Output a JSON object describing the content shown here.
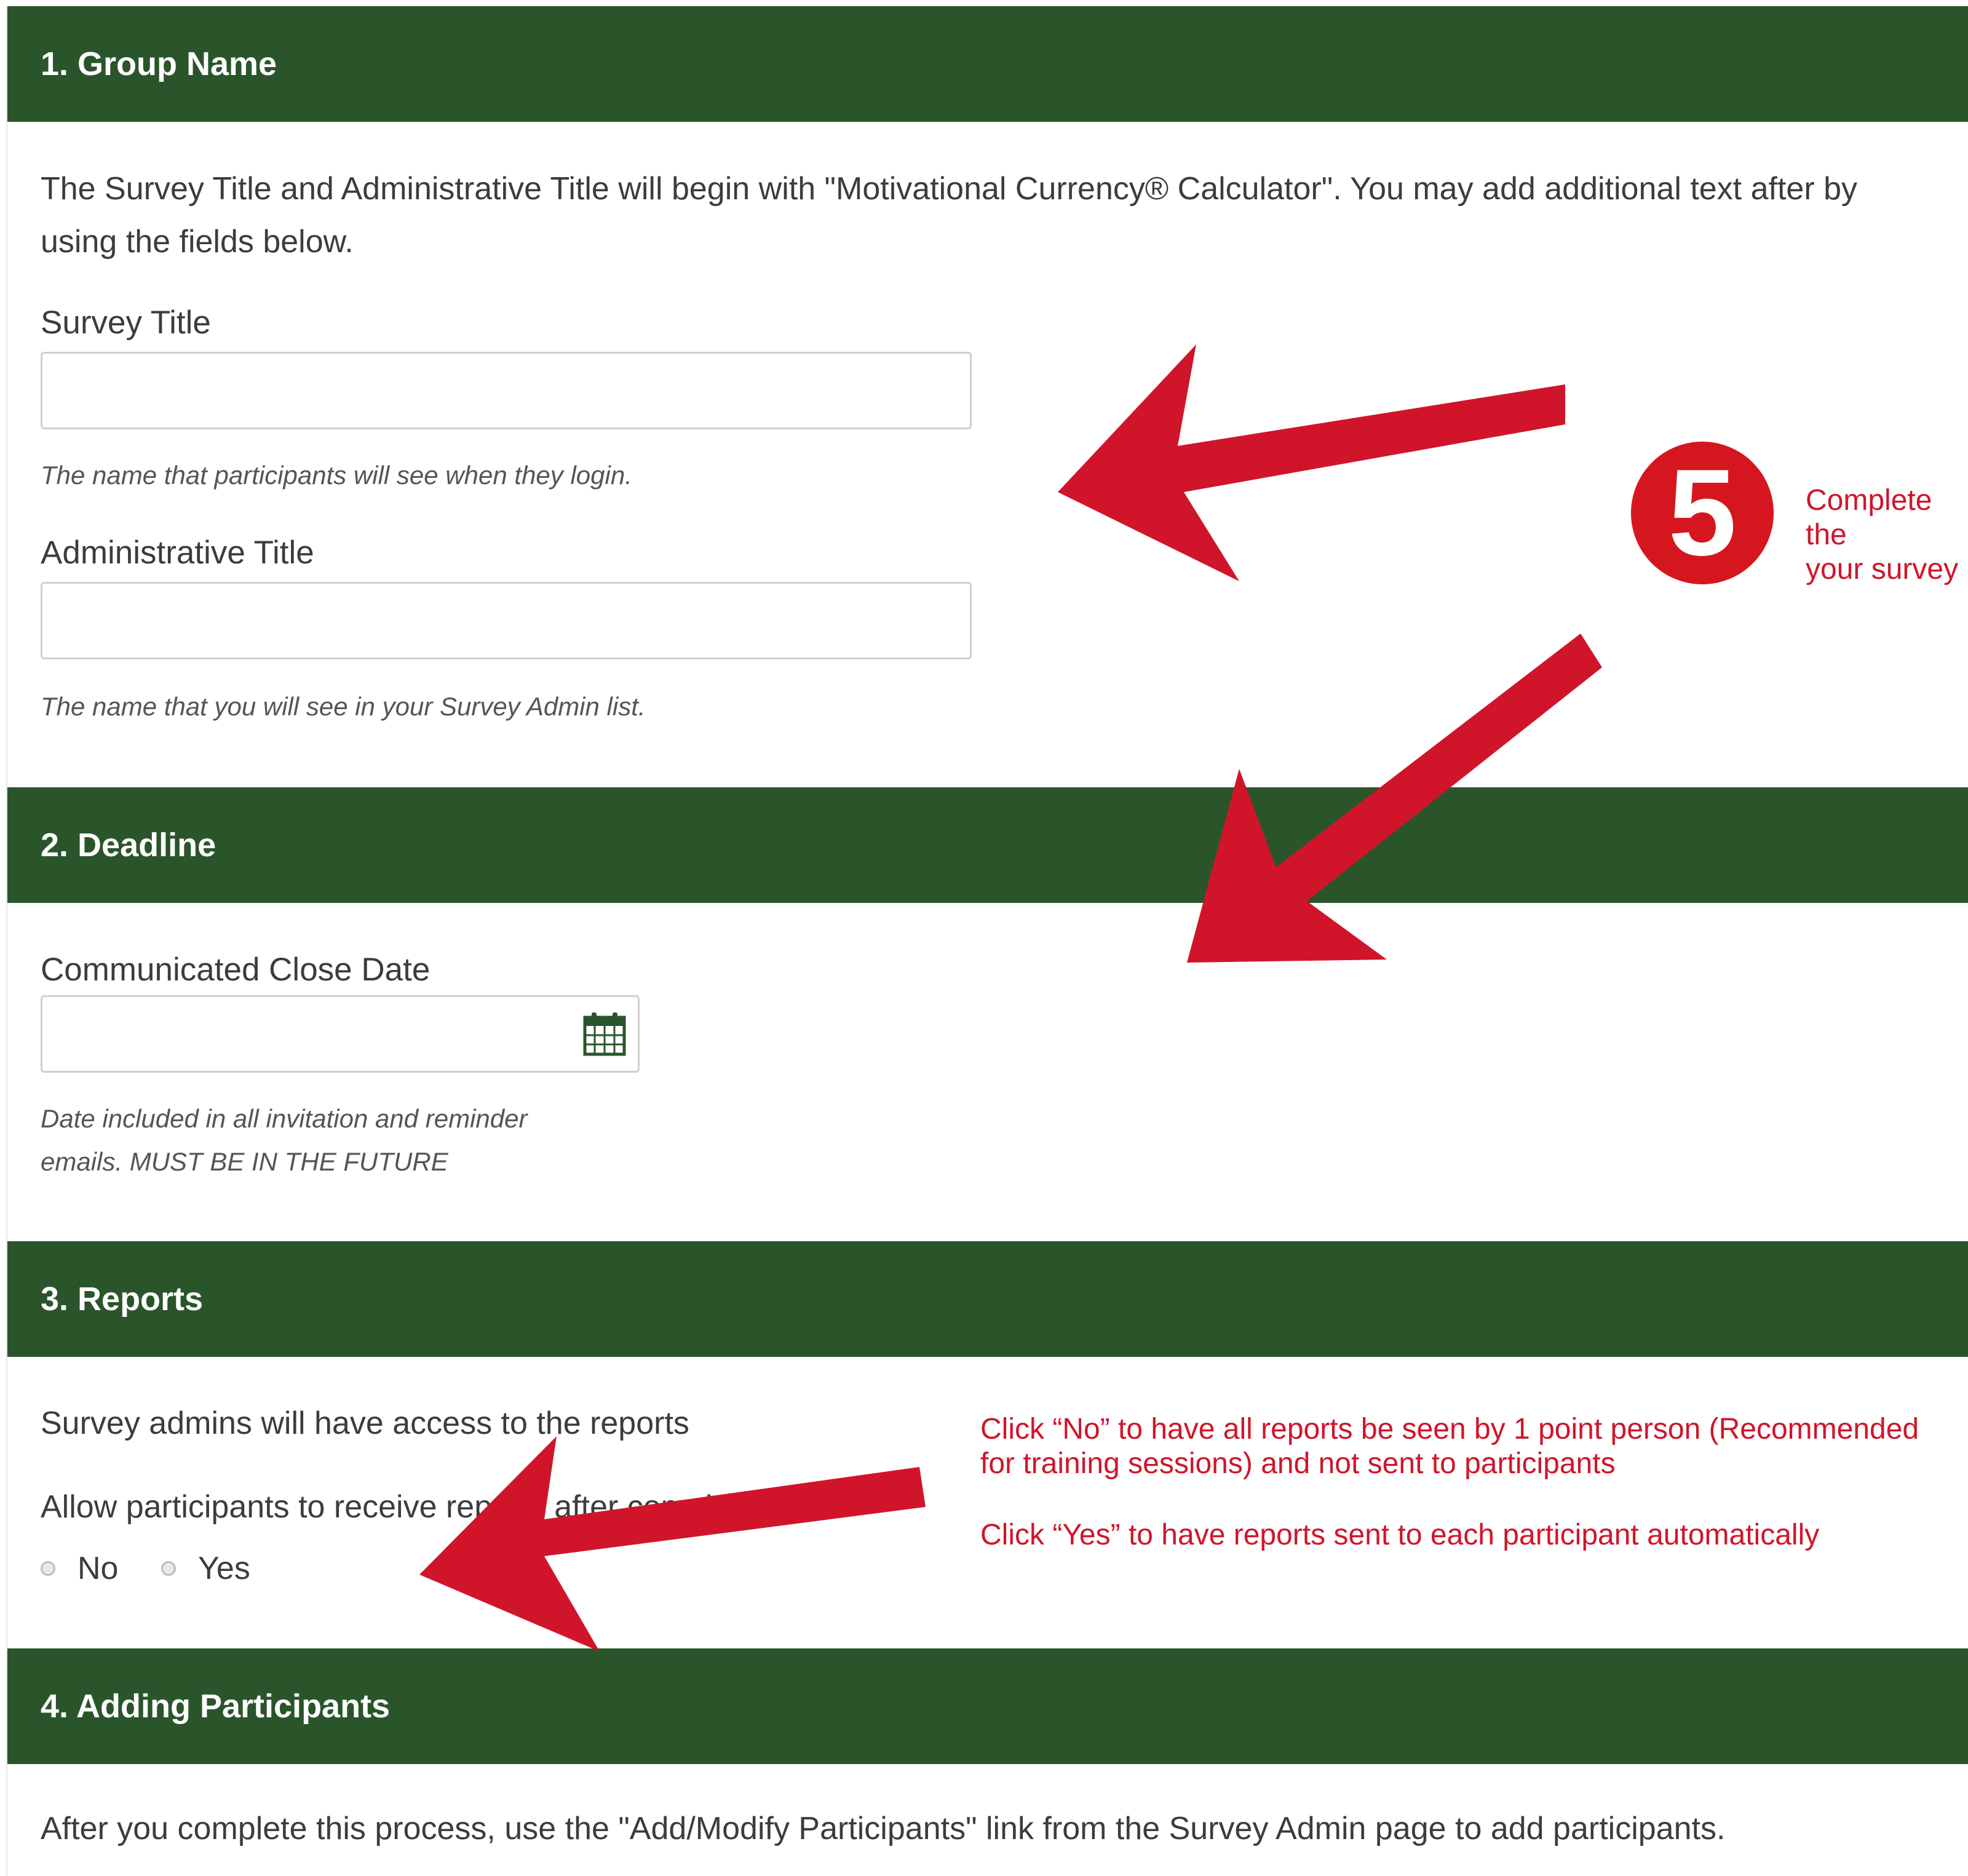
{
  "sections": {
    "group_name": {
      "title": "1. Group Name",
      "intro_line1": "The Survey Title and Administrative Title will begin with \"Motivational Currency® Calculator\". You may add additional text after by",
      "intro_line2": "using the fields below.",
      "survey_title_label": "Survey Title",
      "survey_title_value": "",
      "survey_title_help": "The name that participants will see when they login.",
      "admin_title_label": "Administrative Title",
      "admin_title_value": "",
      "admin_title_help": "The name that you will see in your Survey Admin list."
    },
    "deadline": {
      "title": "2. Deadline",
      "close_date_label": "Communicated Close Date",
      "close_date_value": "",
      "close_date_help_line1": "Date included in all invitation and reminder",
      "close_date_help_line2": "emails. MUST BE IN THE FUTURE"
    },
    "reports": {
      "title": "3. Reports",
      "admin_access_text": "Survey admins will have access to the reports",
      "allow_text": "Allow participants to receive reports after completion",
      "options": [
        "No",
        "Yes"
      ]
    },
    "adding_participants": {
      "title": "4. Adding Participants",
      "text": "After you complete this process, use the \"Add/Modify Participants\" link from the Survey Admin page to add participants."
    }
  },
  "annotations": {
    "step_number": "5",
    "step_text_line1": "Complete the",
    "step_text_line2": "your survey",
    "reports_no_line1": "Click “No” to have all reports be seen by 1 point person (Recommended",
    "reports_no_line2": "for training sessions) and not sent to participants",
    "reports_yes": "Click “Yes” to have reports sent to each participant automatically",
    "arrow_color": "#d0152a"
  },
  "icons": {
    "calendar": "calendar-icon"
  },
  "colors": {
    "header_bg": "#2a552b",
    "annotation_red": "#d0152a"
  }
}
